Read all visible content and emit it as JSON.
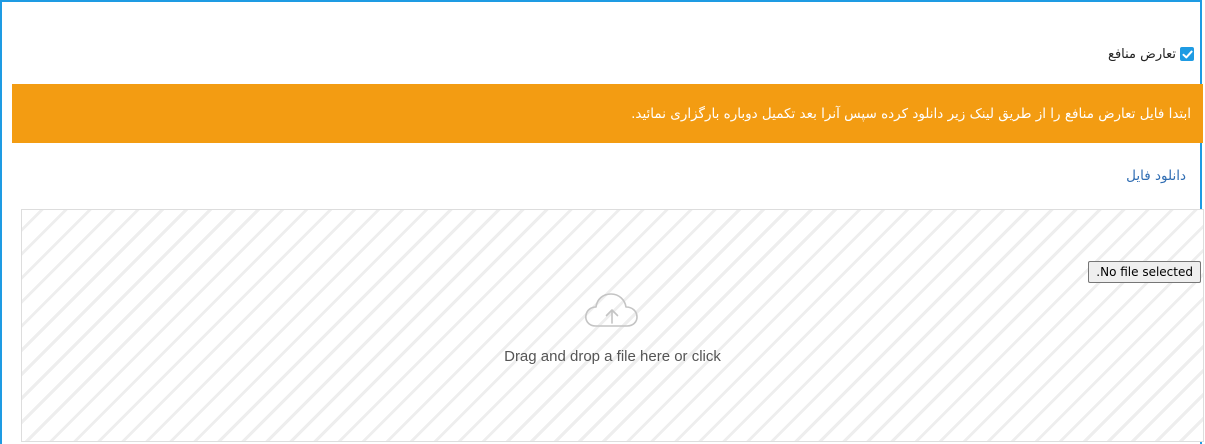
{
  "conflict": {
    "label": "تعارض منافع",
    "checked": true,
    "checkbox_color": "#1e9be3"
  },
  "alert": {
    "message": "ابتدا فایل تعارض منافع را از طریق لینک زیر دانلود کرده سپس آنرا بعد تکمیل دوباره بارگزاری نمائید.",
    "background": "#f39c12"
  },
  "download": {
    "label": "دانلود فایل",
    "link_color": "#2f6db3"
  },
  "dropzone": {
    "file_status": ".No file selected",
    "message": "Drag and drop a file here or click",
    "icon": "cloud-upload-icon"
  },
  "frame": {
    "accent": "#1e9be3"
  }
}
